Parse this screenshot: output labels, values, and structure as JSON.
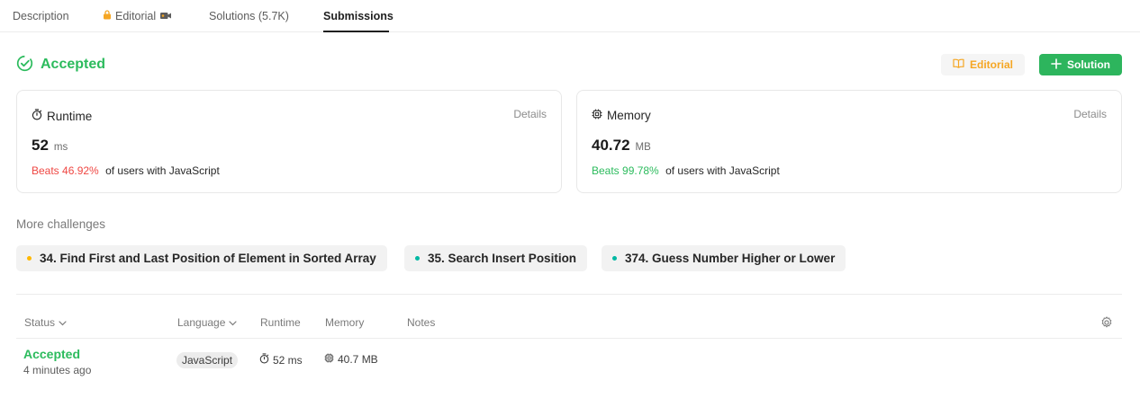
{
  "tabs": {
    "description": "Description",
    "editorial": "Editorial",
    "solutions": "Solutions (5.7K)",
    "submissions": "Submissions"
  },
  "status": {
    "title": "Accepted",
    "editorial_button": "Editorial",
    "solution_button": "Solution"
  },
  "colors": {
    "accepted_green": "#2cbb5d",
    "beats_red": "#ef4743",
    "editorial_orange": "#f5a623",
    "solution_button_bg": "#2db55d",
    "easy_dot": "#00b8a3",
    "medium_dot": "#ffb800"
  },
  "runtime_card": {
    "label": "Runtime",
    "details": "Details",
    "value": "52",
    "unit": "ms",
    "beats": "Beats 46.92%",
    "beats_suffix": "of users with JavaScript"
  },
  "memory_card": {
    "label": "Memory",
    "details": "Details",
    "value": "40.72",
    "unit": "MB",
    "beats": "Beats 99.78%",
    "beats_suffix": "of users with JavaScript"
  },
  "more_challenges": {
    "title": "More challenges",
    "items": [
      {
        "label": "34. Find First and Last Position of Element in Sorted Array",
        "difficulty": "medium"
      },
      {
        "label": "35. Search Insert Position",
        "difficulty": "easy"
      },
      {
        "label": "374. Guess Number Higher or Lower",
        "difficulty": "easy"
      }
    ]
  },
  "table": {
    "headers": {
      "status": "Status",
      "language": "Language",
      "runtime": "Runtime",
      "memory": "Memory",
      "notes": "Notes"
    },
    "rows": [
      {
        "status": "Accepted",
        "time": "4 minutes ago",
        "language": "JavaScript",
        "runtime": "52 ms",
        "memory": "40.7 MB"
      }
    ]
  }
}
